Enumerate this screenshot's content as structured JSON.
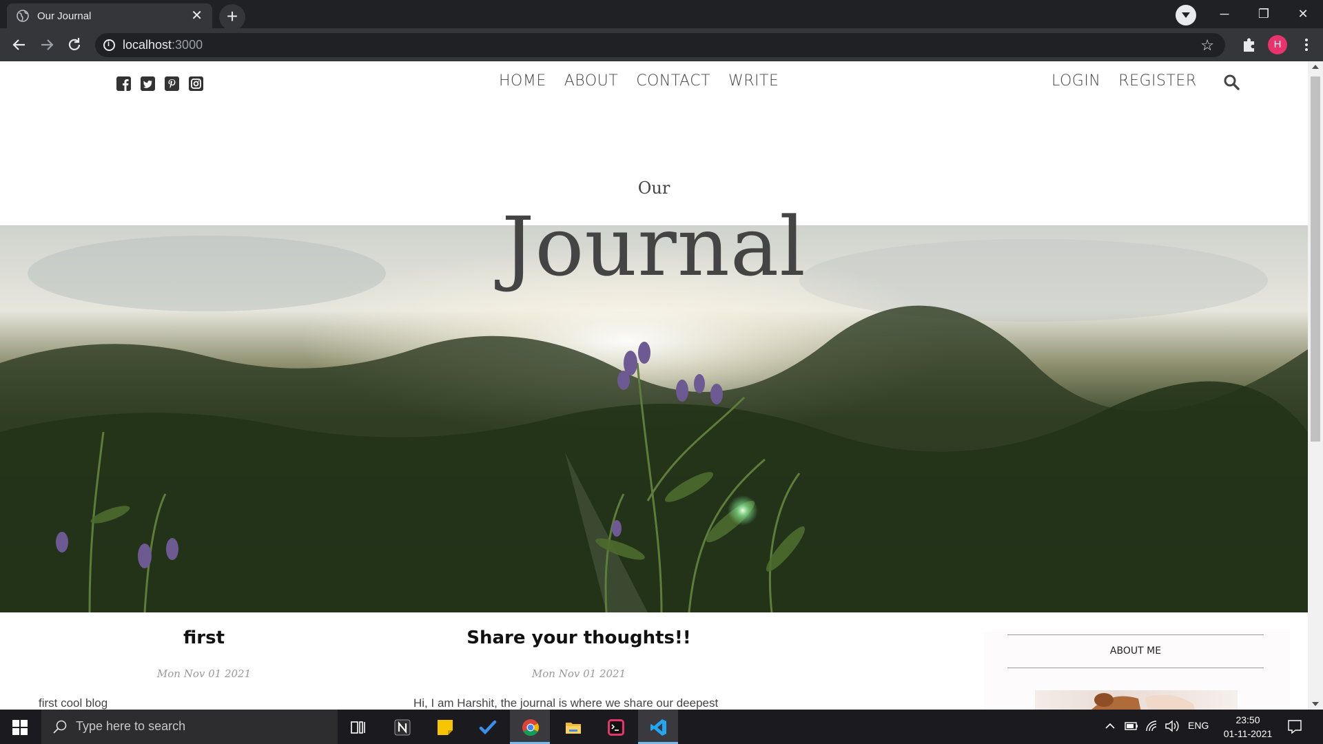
{
  "browser": {
    "tab_title": "Our Journal",
    "url_host": "localhost",
    "url_port": ":3000",
    "profile_initial": "H"
  },
  "site": {
    "nav": [
      {
        "label": "HOME"
      },
      {
        "label": "ABOUT"
      },
      {
        "label": "CONTACT"
      },
      {
        "label": "WRITE"
      }
    ],
    "auth": [
      {
        "label": "LOGIN"
      },
      {
        "label": "REGISTER"
      }
    ],
    "hero_subtitle": "Our",
    "hero_title": "Journal",
    "posts": [
      {
        "title": "first",
        "date": "Mon Nov 01 2021",
        "excerpt": "first cool blog"
      },
      {
        "title": "Share your thoughts!!",
        "date": "Mon Nov 01 2021",
        "excerpt": "Hi, I am Harshit, the journal is where we share our deepest"
      }
    ],
    "sidebar_title": "ABOUT ME"
  },
  "taskbar": {
    "search_placeholder": "Type here to search",
    "lang": "ENG",
    "time": "23:50",
    "date": "01-11-2021"
  },
  "colors": {
    "accent_profile": "#e8336d",
    "text_primary": "#444444"
  }
}
